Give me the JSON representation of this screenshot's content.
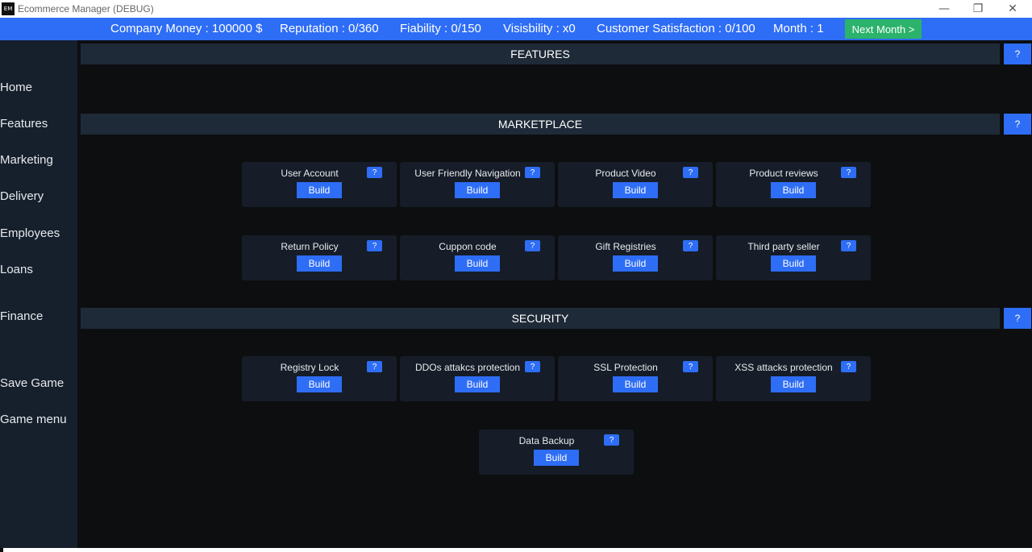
{
  "window": {
    "title": "Ecommerce Manager (DEBUG)",
    "icon_text": "EM",
    "controls": [
      "minimize-icon",
      "restore-icon",
      "close-icon"
    ]
  },
  "stats": {
    "money": "Company Money : 100000 $",
    "reputation": "Reputation : 0/360",
    "fiability": "Fiability : 0/150",
    "visibility": "Visisbility : x0",
    "satisfaction": "Customer Satisfaction : 0/100",
    "month": "Month : 1",
    "next_month": "Next Month >"
  },
  "sidebar": {
    "items": [
      "Home",
      "Features",
      "Marketing",
      "Delivery",
      "Employees",
      "Loans",
      "Finance",
      "Save Game",
      "Game menu"
    ]
  },
  "sections": {
    "features": "FEATURES",
    "marketplace": "MARKETPLACE",
    "security": "SECURITY",
    "help": "?"
  },
  "marketplace_cards": [
    "User Account",
    "User Friendly Navigation",
    "Product Video",
    "Product reviews",
    "Return Policy",
    "Cuppon code",
    "Gift Registries",
    "Third party seller"
  ],
  "security_cards": [
    "Registry Lock",
    "DDOs attakcs protection",
    "SSL Protection",
    "XSS attacks protection",
    "Data Backup"
  ],
  "card_button": "Build",
  "card_help": "?",
  "colors": {
    "accent": "#2e6df5",
    "next": "#2bb36b",
    "bg": "#0d0e10",
    "sidebar": "#16202c",
    "card": "#161d28",
    "header": "#1f2a38"
  }
}
